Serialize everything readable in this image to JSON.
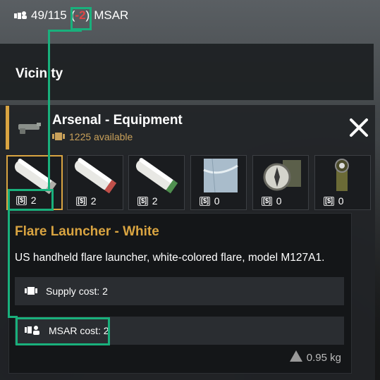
{
  "hud": {
    "count": "49/115",
    "delta_open": "(",
    "delta": "-2",
    "delta_close": ")",
    "unit": "MSAR"
  },
  "vicinity": {
    "title": "Vicinity"
  },
  "arsenal": {
    "title": "Arsenal - Equipment",
    "available": "1225 available"
  },
  "slots": [
    {
      "name": "Flare Launcher - White",
      "cost": "2"
    },
    {
      "name": "Flare Launcher - Red",
      "cost": "2"
    },
    {
      "name": "Flare Launcher - Green",
      "cost": "2"
    },
    {
      "name": "Map",
      "cost": "0"
    },
    {
      "name": "Compass",
      "cost": "0"
    },
    {
      "name": "Flashlight",
      "cost": "0"
    }
  ],
  "tooltip": {
    "title": "Flare Launcher - White",
    "description": "US handheld flare launcher, white-colored flare, model M127A1.",
    "supply_cost": "Supply cost: 2",
    "msar_cost": "MSAR cost: 2",
    "weight": "0.95 kg"
  },
  "colors": {
    "accent": "#d9a441",
    "highlight": "#19b07c",
    "negative": "#e04444"
  }
}
